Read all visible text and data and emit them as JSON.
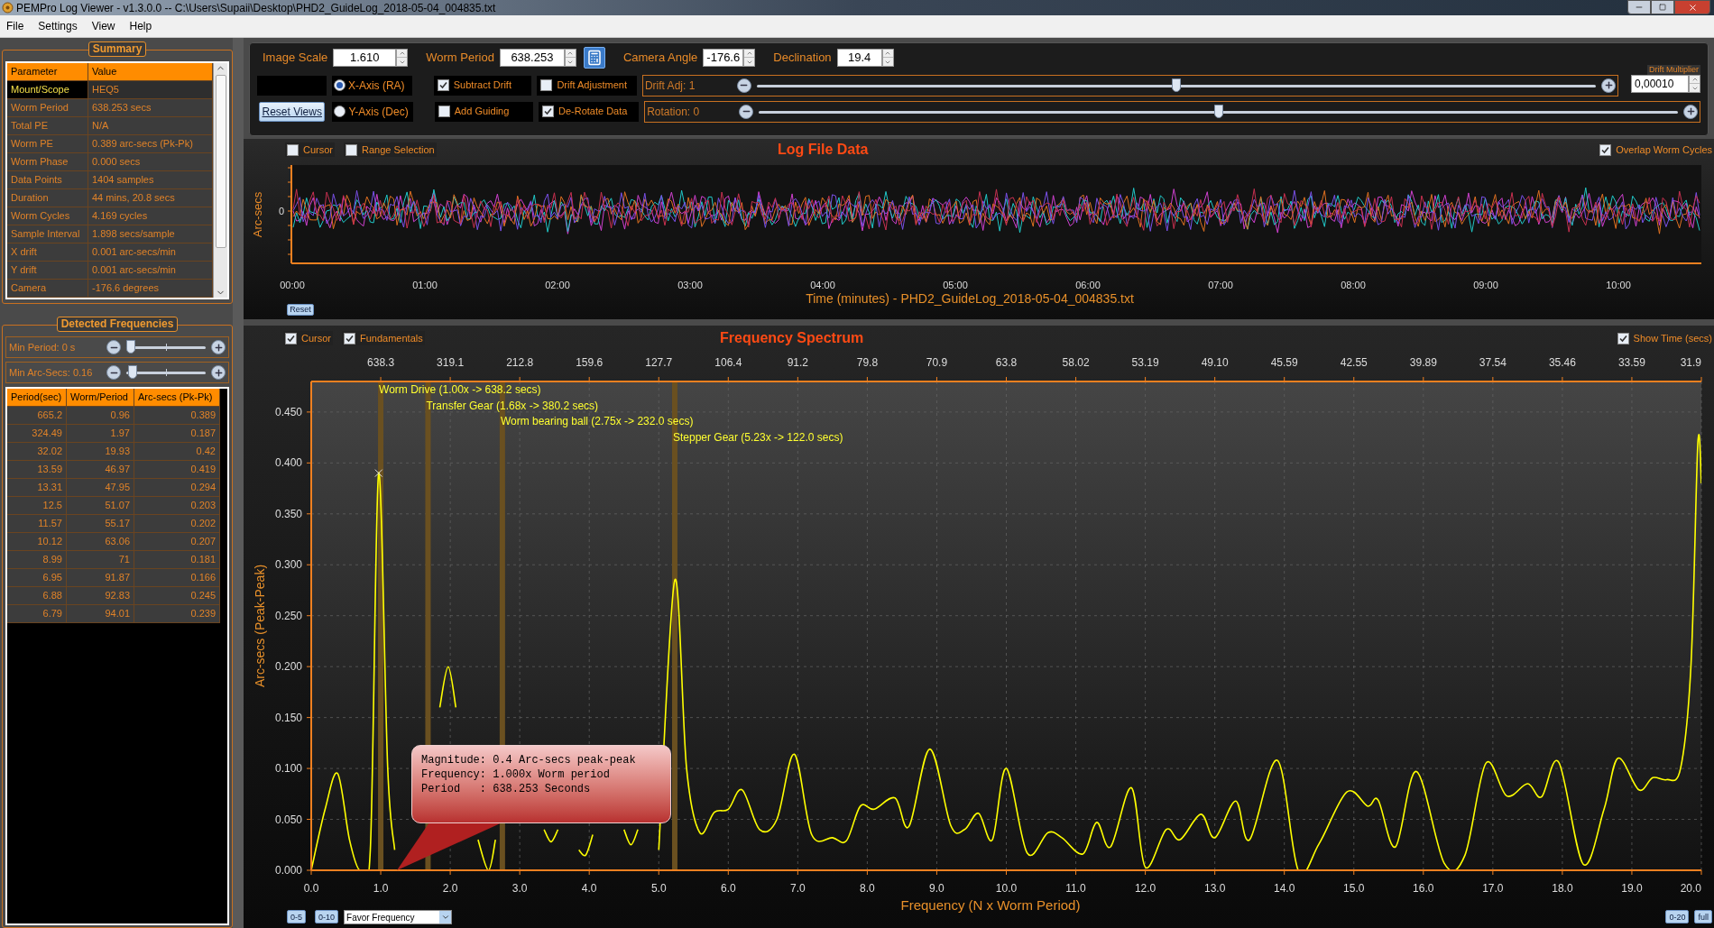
{
  "window": {
    "title": "PEMPro Log Viewer - v1.3.0.0 -- C:\\Users\\Supaii\\Desktop\\PHD2_GuideLog_2018-05-04_004835.txt"
  },
  "menu": [
    "File",
    "Settings",
    "View",
    "Help"
  ],
  "summary": {
    "title": "Summary",
    "columns": [
      "Parameter",
      "Value"
    ],
    "rows": [
      {
        "cells": [
          "Mount/Scope",
          "HEQ5"
        ],
        "selected": true
      },
      {
        "cells": [
          "Worm Period",
          "638.253 secs"
        ],
        "selected": false
      },
      {
        "cells": [
          "Total PE",
          "N/A"
        ],
        "selected": false
      },
      {
        "cells": [
          "Worm PE",
          "0.389 arc-secs (Pk-Pk)"
        ],
        "selected": false
      },
      {
        "cells": [
          "Worm Phase",
          "0.000 secs"
        ],
        "selected": false
      },
      {
        "cells": [
          "Data Points",
          "1404 samples"
        ],
        "selected": false
      },
      {
        "cells": [
          "Duration",
          "44 mins, 20.8 secs"
        ],
        "selected": false
      },
      {
        "cells": [
          "Worm Cycles",
          "4.169 cycles"
        ],
        "selected": false
      },
      {
        "cells": [
          "Sample Interval",
          "1.898 secs/sample"
        ],
        "selected": false
      },
      {
        "cells": [
          "X drift",
          "0.001 arc-secs/min"
        ],
        "selected": false
      },
      {
        "cells": [
          "Y drift",
          "0.001 arc-secs/min"
        ],
        "selected": false
      },
      {
        "cells": [
          "Camera",
          "-176.6 degrees"
        ],
        "selected": false
      }
    ]
  },
  "detected_frequencies": {
    "title": "Detected Frequencies",
    "sliders": [
      {
        "label": "Min Period: 0 s",
        "level": 0.06
      },
      {
        "label": "Min Arc-Secs: 0.16",
        "level": 0.08
      }
    ],
    "columns": [
      "Period(sec)",
      "Worm/Period",
      "Arc-secs (Pk-Pk)"
    ],
    "rows": [
      [
        "665.2",
        "0.96",
        "0.389"
      ],
      [
        "324.49",
        "1.97",
        "0.187"
      ],
      [
        "32.02",
        "19.93",
        "0.42"
      ],
      [
        "13.59",
        "46.97",
        "0.419"
      ],
      [
        "13.31",
        "47.95",
        "0.294"
      ],
      [
        "12.5",
        "51.07",
        "0.203"
      ],
      [
        "11.57",
        "55.17",
        "0.202"
      ],
      [
        "10.12",
        "63.06",
        "0.207"
      ],
      [
        "8.99",
        "71",
        "0.181"
      ],
      [
        "6.95",
        "91.87",
        "0.166"
      ],
      [
        "6.88",
        "92.83",
        "0.245"
      ],
      [
        "6.79",
        "94.01",
        "0.239"
      ]
    ]
  },
  "toolbar": {
    "fields": [
      {
        "label": "Image Scale",
        "value": "1.610"
      },
      {
        "label": "Worm Period",
        "value": "638.253"
      },
      {
        "label": "Camera Angle",
        "value": "-176.6"
      },
      {
        "label": "Declination",
        "value": "19.4"
      }
    ],
    "radios": [
      {
        "label": "X-Axis (RA)",
        "selected": true
      },
      {
        "label": "Y-Axis (Dec)",
        "selected": false
      }
    ],
    "checkboxes": [
      {
        "label": "Subtract Drift",
        "checked": true
      },
      {
        "label": "Drift Adjustment",
        "checked": false
      },
      {
        "label": "Add Guiding",
        "checked": false
      },
      {
        "label": "De-Rotate Data",
        "checked": true
      }
    ],
    "sliders": [
      {
        "label": "Drift Adj: 1",
        "level": 0.5
      },
      {
        "label": "Rotation: 0",
        "level": 0.5
      }
    ],
    "drift_multiplier": {
      "label": "Drift Multiplier",
      "value": "0,00010"
    },
    "reset_button": "Reset Views"
  },
  "log_chart": {
    "title": "Log File Data",
    "checkboxes": [
      {
        "label": "Cursor",
        "checked": false
      },
      {
        "label": "Range Selection",
        "checked": false
      }
    ],
    "overlap": {
      "label": "Overlap Worm Cycles",
      "checked": true
    },
    "ylabel": "Arc-secs",
    "ytick": "0",
    "xticks": [
      "00:00",
      "01:00",
      "02:00",
      "03:00",
      "04:00",
      "05:00",
      "06:00",
      "07:00",
      "08:00",
      "09:00",
      "10:00"
    ],
    "xlabel": "Time (minutes) - PHD2_GuideLog_2018-05-04_004835.txt",
    "reset_button": "Reset"
  },
  "spectrum": {
    "title": "Frequency Spectrum",
    "checkboxes": [
      {
        "label": "Cursor",
        "checked": true
      },
      {
        "label": "Fundamentals",
        "checked": true
      }
    ],
    "show_time": {
      "label": "Show Time (secs)",
      "checked": true
    },
    "period_labels": [
      "638.3",
      "319.1",
      "212.8",
      "159.6",
      "127.7",
      "106.4",
      "91.2",
      "79.8",
      "70.9",
      "63.8",
      "58.02",
      "53.19",
      "49.10",
      "45.59",
      "42.55",
      "39.89",
      "37.54",
      "35.46",
      "33.59",
      "31.9"
    ],
    "chart_data": {
      "type": "line",
      "xlabel": "Frequency (N x Worm Period)",
      "ylabel": "Arc-secs (Peak-Peak)",
      "xlim": [
        0,
        20
      ],
      "ylim": [
        0,
        0.48
      ],
      "xticks": [
        {
          "value": 0,
          "label": "0.0"
        },
        {
          "value": 1,
          "label": "1.0"
        },
        {
          "value": 2,
          "label": "2.0"
        },
        {
          "value": 3,
          "label": "3.0"
        },
        {
          "value": 4,
          "label": "4.0"
        },
        {
          "value": 5,
          "label": "5.0"
        },
        {
          "value": 6,
          "label": "6.0"
        },
        {
          "value": 7,
          "label": "7.0"
        },
        {
          "value": 8,
          "label": "8.0"
        },
        {
          "value": 9,
          "label": "9.0"
        },
        {
          "value": 10,
          "label": "10.0"
        },
        {
          "value": 11,
          "label": "11.0"
        },
        {
          "value": 12,
          "label": "12.0"
        },
        {
          "value": 13,
          "label": "13.0"
        },
        {
          "value": 14,
          "label": "14.0"
        },
        {
          "value": 15,
          "label": "15.0"
        },
        {
          "value": 16,
          "label": "16.0"
        },
        {
          "value": 17,
          "label": "17.0"
        },
        {
          "value": 18,
          "label": "18.0"
        },
        {
          "value": 19,
          "label": "19.0"
        },
        {
          "value": 20,
          "label": "20.0"
        }
      ],
      "yticks": [
        {
          "value": 0,
          "label": "0.000"
        },
        {
          "value": 0.05,
          "label": "0.050"
        },
        {
          "value": 0.1,
          "label": "0.100"
        },
        {
          "value": 0.15,
          "label": "0.150"
        },
        {
          "value": 0.2,
          "label": "0.200"
        },
        {
          "value": 0.25,
          "label": "0.250"
        },
        {
          "value": 0.3,
          "label": "0.300"
        },
        {
          "value": 0.35,
          "label": "0.350"
        },
        {
          "value": 0.4,
          "label": "0.400"
        },
        {
          "value": 0.45,
          "label": "0.450"
        }
      ],
      "grid": true,
      "x": [
        0,
        0.2,
        0.38,
        0.55,
        0.7,
        0.85,
        0.97,
        1.1,
        1.2,
        1.3,
        1.45,
        1.6,
        1.75,
        1.85,
        1.97,
        2.08,
        2.2,
        2.4,
        2.55,
        2.65,
        2.75,
        3.0,
        3.2,
        3.35,
        3.45,
        3.55,
        3.7,
        3.85,
        3.95,
        4.05,
        4.2,
        4.5,
        4.6,
        4.7,
        4.85,
        5.0,
        5.23,
        5.4,
        5.59,
        5.8,
        6.0,
        6.2,
        6.45,
        6.7,
        6.95,
        7.2,
        7.5,
        7.7,
        7.9,
        8.1,
        8.4,
        8.6,
        8.9,
        9.2,
        9.4,
        9.6,
        9.8,
        10.0,
        10.3,
        10.6,
        10.8,
        11.1,
        11.3,
        11.5,
        11.8,
        12.0,
        12.3,
        12.5,
        12.8,
        13.0,
        13.3,
        13.5,
        13.9,
        14.2,
        14.5,
        14.9,
        15.2,
        15.35,
        15.6,
        15.9,
        16.3,
        16.6,
        16.9,
        17.2,
        17.5,
        17.7,
        17.95,
        18.3,
        18.6,
        18.8,
        19.1,
        19.3,
        19.5,
        19.7,
        19.85,
        19.95,
        20
      ],
      "series": [
        {
          "color": "#ffff00",
          "values": [
            0,
            0.06,
            0.095,
            0.03,
            0.0,
            0.02,
            0.39,
            0.1,
            0.02,
            null,
            null,
            null,
            null,
            0.16,
            0.2,
            0.16,
            null,
            0.03,
            0.0,
            0.03,
            null,
            null,
            null,
            0.04,
            0.028,
            0.04,
            null,
            0.02,
            0.015,
            0.035,
            null,
            0.04,
            0.025,
            0.04,
            null,
            0.02,
            0.285,
            0.1,
            0.037,
            0.057,
            0.06,
            0.079,
            0.04,
            0.05,
            0.114,
            0.035,
            0.032,
            0.029,
            0.063,
            0.06,
            0.071,
            0.043,
            0.119,
            0.044,
            0.04,
            0.056,
            0.03,
            0.1,
            0.017,
            0.037,
            0.032,
            0.016,
            0.047,
            0.023,
            0.081,
            0.003,
            0.04,
            0.03,
            0.055,
            0.032,
            0.068,
            0.03,
            0.108,
            0.0,
            0.026,
            0.077,
            0.063,
            0.069,
            0.023,
            0.097,
            0.007,
            0.015,
            0.105,
            0.073,
            0.085,
            0.072,
            0.106,
            0.006,
            0.06,
            0.11,
            0.079,
            0.091,
            0.089,
            0.1,
            0.2,
            0.42,
            0.38
          ]
        }
      ],
      "ref_lines": [
        {
          "axis": "x",
          "value": 1.0,
          "label": "Worm Drive (1.00x -> 638.2 secs)"
        },
        {
          "axis": "x",
          "value": 1.68,
          "label": "Transfer Gear (1.68x -> 380.2 secs)"
        },
        {
          "axis": "x",
          "value": 2.75,
          "label": "Worm bearing ball (2.75x -> 232.0 secs)"
        },
        {
          "axis": "x",
          "value": 5.23,
          "label": "Stepper Gear (5.23x -> 122.0 secs)"
        }
      ]
    },
    "tooltip": [
      "Magnitude: 0.4 Arc-secs peak-peak",
      "Frequency: 1.000x Worm period",
      "Period   : 638.253 Seconds"
    ],
    "range_buttons_left": [
      "0-5",
      "0-10"
    ],
    "dropdown": {
      "value": "Favor Frequency"
    },
    "range_buttons_right": [
      "0-20",
      "full"
    ]
  }
}
